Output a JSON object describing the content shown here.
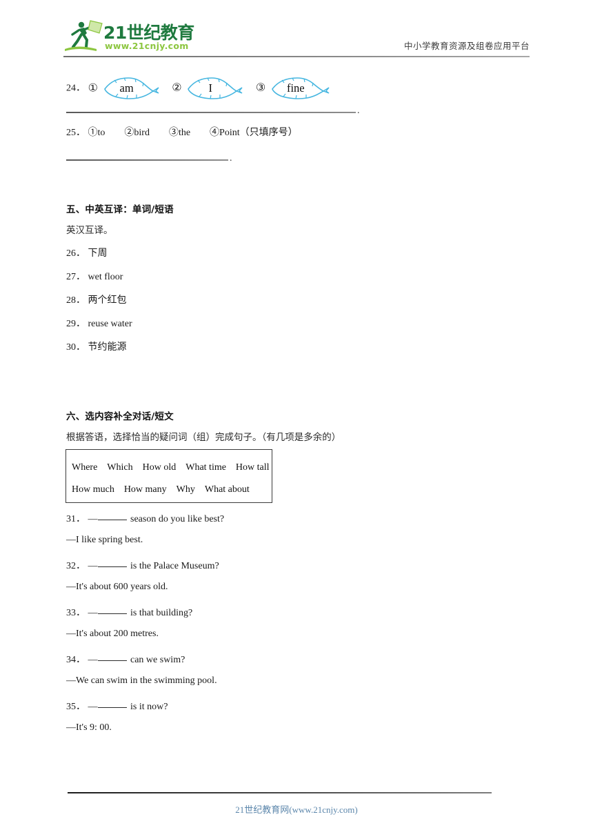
{
  "header": {
    "logo_main_text": "21世纪教育",
    "logo_url_text": "www.21cnjy.com",
    "tagline": "中小学教育资源及组卷应用平台"
  },
  "questions_prev": [
    {
      "number": "24．",
      "items": [
        {
          "marker": "①",
          "word": "am"
        },
        {
          "marker": "②",
          "word": "I"
        },
        {
          "marker": "③",
          "word": "fine"
        }
      ],
      "answer_period": "."
    },
    {
      "number": "25．",
      "text": "①to　　②bird　　③the　　④Point（只填序号）",
      "answer_period": "."
    }
  ],
  "section_five": {
    "heading": "五、中英互译：单词/短语",
    "subtitle": "英汉互译。",
    "items": [
      {
        "number": "26．",
        "text": "下周"
      },
      {
        "number": "27．",
        "text": "wet floor"
      },
      {
        "number": "28．",
        "text": "两个红包"
      },
      {
        "number": "29．",
        "text": "reuse water"
      },
      {
        "number": "30．",
        "text": "节约能源"
      }
    ]
  },
  "section_six": {
    "heading": "六、选内容补全对话/短文",
    "subtitle": "根据答语，选择恰当的疑问词（组）完成句子。（有几项是多余的）",
    "word_bank": {
      "row1": "Where　Which　How old　What time　How tall",
      "row2": "How much　How many　Why　What about"
    },
    "dialogues": [
      {
        "number": "31．",
        "prefix": "—",
        "suffix": "season do you like best?",
        "answer": "—I like spring best."
      },
      {
        "number": "32．",
        "prefix": "—",
        "suffix": "is the Palace Museum?",
        "answer": "—It's about 600 years old."
      },
      {
        "number": "33．",
        "prefix": "—",
        "suffix": "is that building?",
        "answer": "—It's about 200 metres."
      },
      {
        "number": "34．",
        "prefix": "—",
        "suffix": "can we swim?",
        "answer": "—We can swim in the swimming pool."
      },
      {
        "number": "35．",
        "prefix": "—",
        "suffix": "is it now?",
        "answer": "—It's 9: 00."
      }
    ]
  },
  "footer": {
    "text": "21世纪教育网(www.21cnjy.com)"
  },
  "colors": {
    "leaf_outline": "#45b6e0",
    "logo_green_dark": "#1f7a3f",
    "logo_green_light": "#8cc63f",
    "footer_blue": "#5b86ab"
  }
}
